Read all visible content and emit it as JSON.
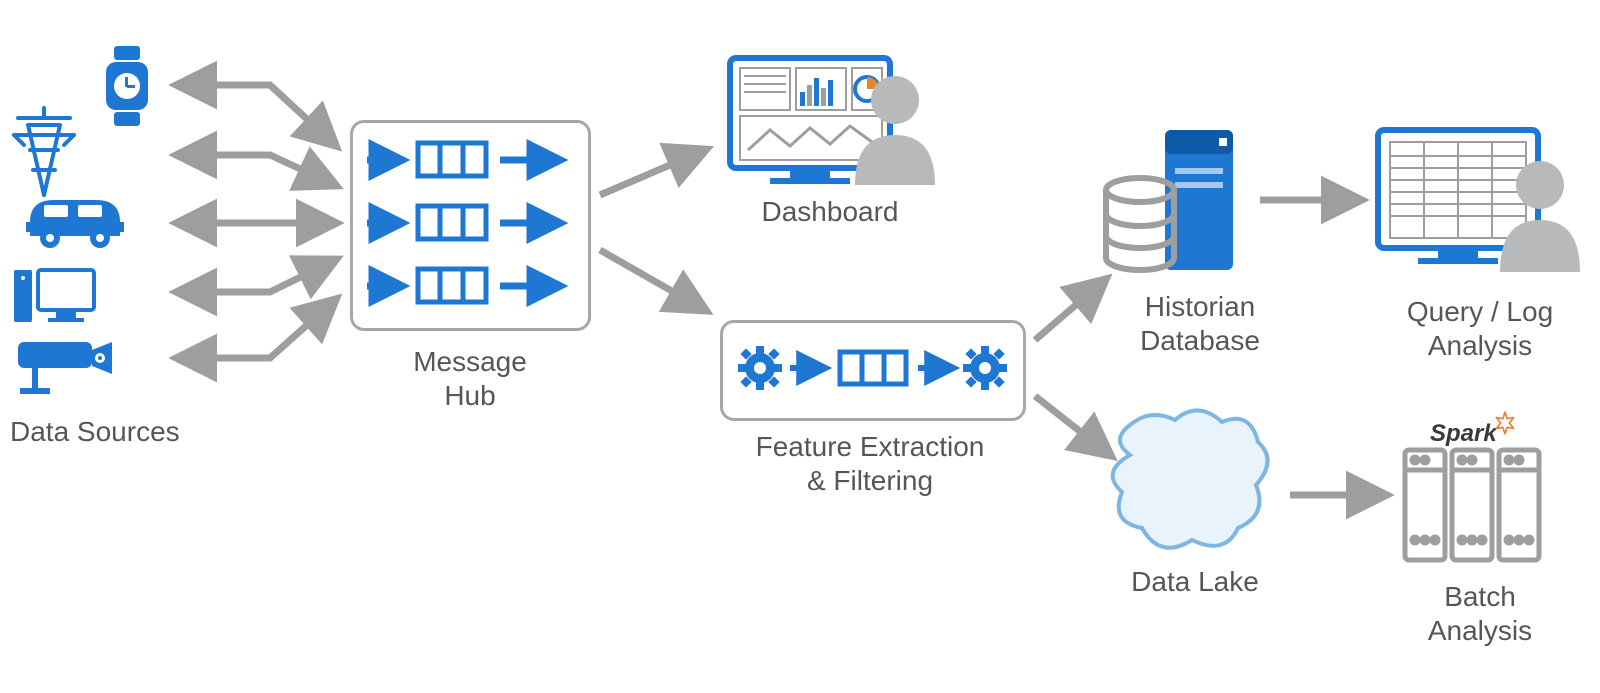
{
  "labels": {
    "dataSources": "Data Sources",
    "messageHub": "Message\nHub",
    "dashboard": "Dashboard",
    "featureExtraction": "Feature Extraction\n& Filtering",
    "historianDatabase": "Historian\nDatabase",
    "queryLogAnalysis": "Query / Log\nAnalysis",
    "dataLake": "Data Lake",
    "batchAnalysis": "Batch\nAnalysis",
    "sparkLogo": "Spark"
  },
  "colors": {
    "blue": "#1f77d4",
    "grey": "#9c9e9f",
    "text": "#54575a",
    "lakeFill": "#e8f3fb",
    "lakeStroke": "#7db5e3"
  },
  "nodes": [
    {
      "id": "data-sources",
      "label": "Data Sources"
    },
    {
      "id": "message-hub",
      "label": "Message Hub"
    },
    {
      "id": "dashboard",
      "label": "Dashboard"
    },
    {
      "id": "feature-extraction",
      "label": "Feature Extraction & Filtering"
    },
    {
      "id": "historian-database",
      "label": "Historian Database"
    },
    {
      "id": "data-lake",
      "label": "Data Lake"
    },
    {
      "id": "query-log-analysis",
      "label": "Query / Log Analysis"
    },
    {
      "id": "batch-analysis",
      "label": "Batch Analysis"
    }
  ],
  "edges": [
    {
      "from": "data-sources",
      "to": "message-hub",
      "bidirectional": true
    },
    {
      "from": "message-hub",
      "to": "dashboard",
      "bidirectional": false
    },
    {
      "from": "message-hub",
      "to": "feature-extraction",
      "bidirectional": false
    },
    {
      "from": "feature-extraction",
      "to": "historian-database",
      "bidirectional": false
    },
    {
      "from": "feature-extraction",
      "to": "data-lake",
      "bidirectional": false
    },
    {
      "from": "historian-database",
      "to": "query-log-analysis",
      "bidirectional": false
    },
    {
      "from": "data-lake",
      "to": "batch-analysis",
      "bidirectional": false
    }
  ],
  "dataSourceIcons": [
    "smartwatch",
    "power-tower",
    "car",
    "desktop-computer",
    "security-camera"
  ]
}
